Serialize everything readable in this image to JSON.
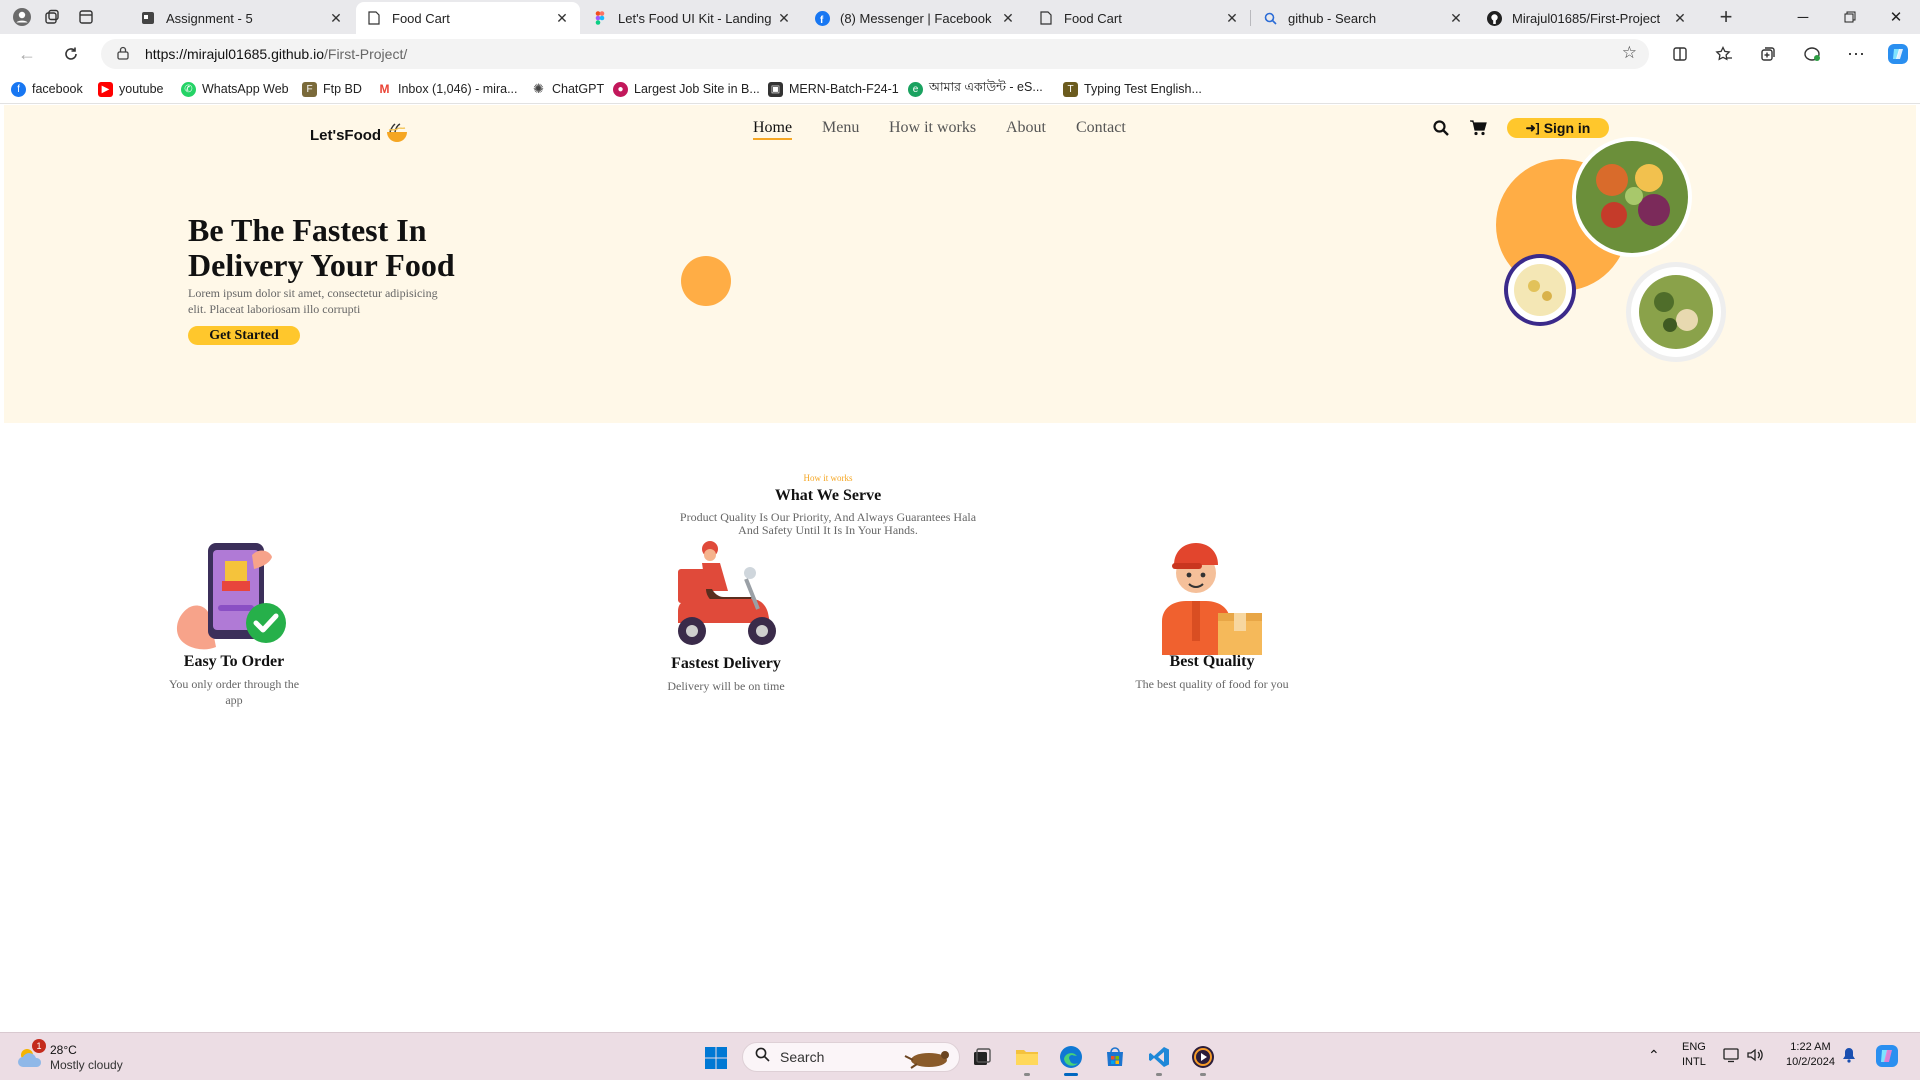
{
  "browser": {
    "tabs": [
      {
        "label": "Assignment - 5",
        "icon": "document-icon"
      },
      {
        "label": "Food Cart",
        "icon": "page-icon",
        "active": true
      },
      {
        "label": "Let's Food UI Kit - Landing Pag",
        "icon": "figma-icon"
      },
      {
        "label": "(8) Messenger | Facebook",
        "icon": "facebook-icon"
      },
      {
        "label": "Food Cart",
        "icon": "page-icon"
      },
      {
        "label": "github - Search",
        "icon": "search-icon"
      },
      {
        "label": "Mirajul01685/First-Project",
        "icon": "github-icon"
      }
    ],
    "url_host": "https://mirajul01685.github.io",
    "url_path": "/First-Project/",
    "bookmarks": [
      {
        "label": "facebook",
        "color": "#1877f2",
        "icon": "facebook-icon"
      },
      {
        "label": "youtube",
        "color": "#ff0000",
        "icon": "youtube-icon"
      },
      {
        "label": "WhatsApp Web",
        "color": "#25d366",
        "icon": "whatsapp-icon"
      },
      {
        "label": "Ftp BD",
        "color": "#7a6a3a",
        "icon": "ftp-icon"
      },
      {
        "label": "Inbox (1,046) - mira...",
        "color": "#ea4335",
        "icon": "gmail-icon"
      },
      {
        "label": "ChatGPT",
        "color": "#444444",
        "icon": "chatgpt-icon"
      },
      {
        "label": "Largest Job Site in B...",
        "color": "#c2185b",
        "icon": "jobs-icon"
      },
      {
        "label": "MERN-Batch-F24-1",
        "color": "#333333",
        "icon": "classroom-icon"
      },
      {
        "label": "আমার একাউন্ট - eS...",
        "color": "#1aa260",
        "icon": "account-icon"
      },
      {
        "label": "Typing Test English...",
        "color": "#6b5b1e",
        "icon": "typing-icon"
      }
    ]
  },
  "site": {
    "brand": "Let'sFood",
    "nav": [
      "Home",
      "Menu",
      "How it works",
      "About",
      "Contact"
    ],
    "signin": "Sign in",
    "hero": {
      "title": "Be The Fastest In Delivery Your Food",
      "text": "Lorem ipsum dolor sit amet, consectetur adipisicing elit. Placeat laboriosam illo corrupti",
      "cta": "Get Started"
    },
    "section": {
      "eyebrow": "How it works",
      "title": "What We Serve",
      "desc": "Product Quality Is Our Priority, And Always Guarantees Hala And Safety Until It Is In Your Hands."
    },
    "features": [
      {
        "title": "Easy To Order",
        "text": "You only order through the app"
      },
      {
        "title": "Fastest Delivery",
        "text": "Delivery will be on time"
      },
      {
        "title": "Best Quality",
        "text": "The best quality of food for you"
      }
    ],
    "colors": {
      "accent": "#ffc72c",
      "orange": "#ffad45",
      "hero_bg": "#fff8e8"
    }
  },
  "taskbar": {
    "weather_temp": "28°C",
    "weather_cond": "Mostly cloudy",
    "weather_badge": "1",
    "search_placeholder": "Search",
    "lang_top": "ENG",
    "lang_bottom": "INTL",
    "time": "1:22 AM",
    "date": "10/2/2024"
  }
}
